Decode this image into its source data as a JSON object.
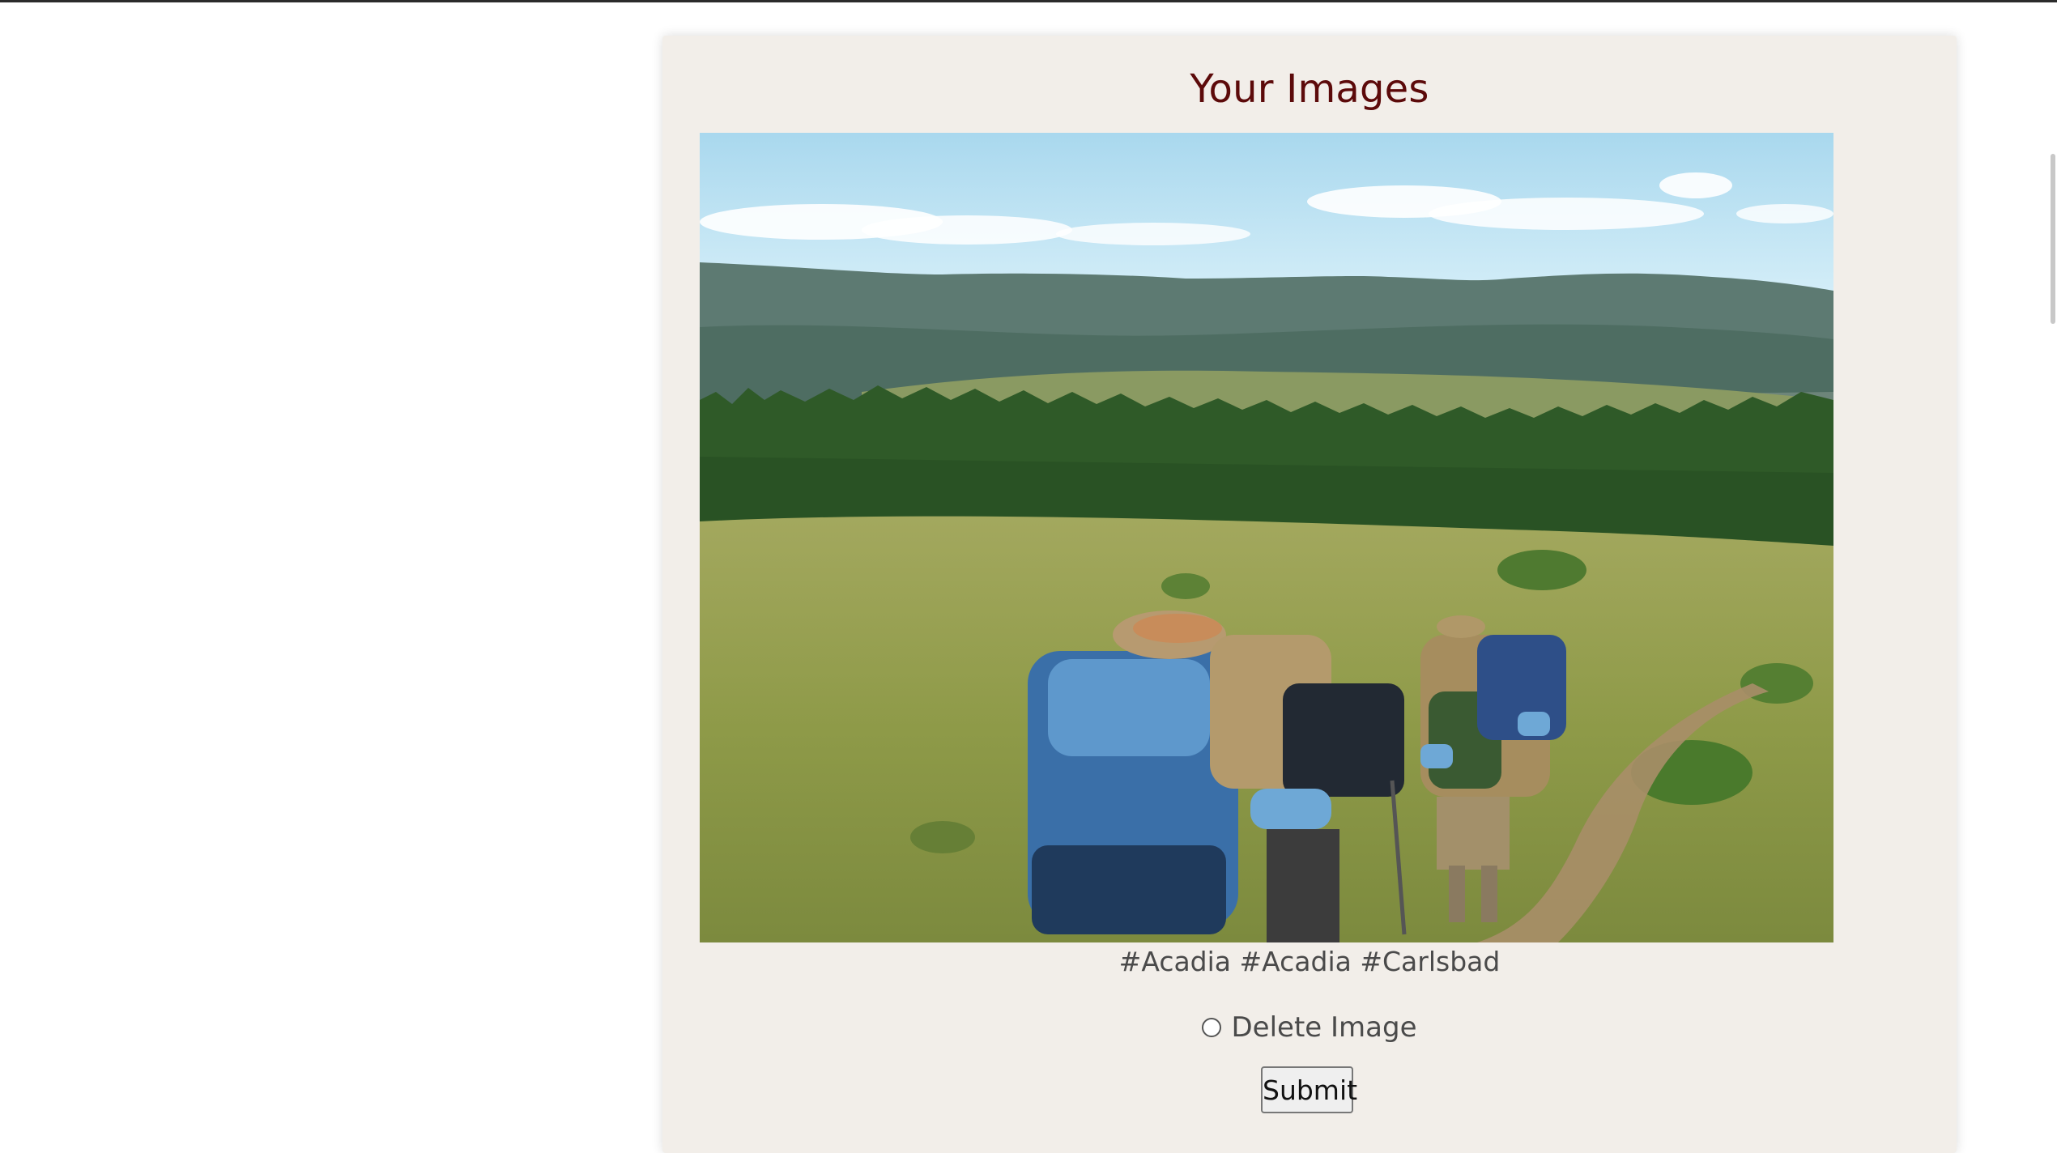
{
  "page": {
    "title": "Your Images"
  },
  "image_entry": {
    "tags": "#Acadia #Acadia #Carlsbad",
    "delete_label": "Delete Image",
    "submit_label": "Submit"
  },
  "colors": {
    "title": "#5c0a0a",
    "card_background": "#f2eee9",
    "text": "#4a4a4a"
  },
  "icons": {
    "photo": "hikers-in-meadow-image"
  }
}
